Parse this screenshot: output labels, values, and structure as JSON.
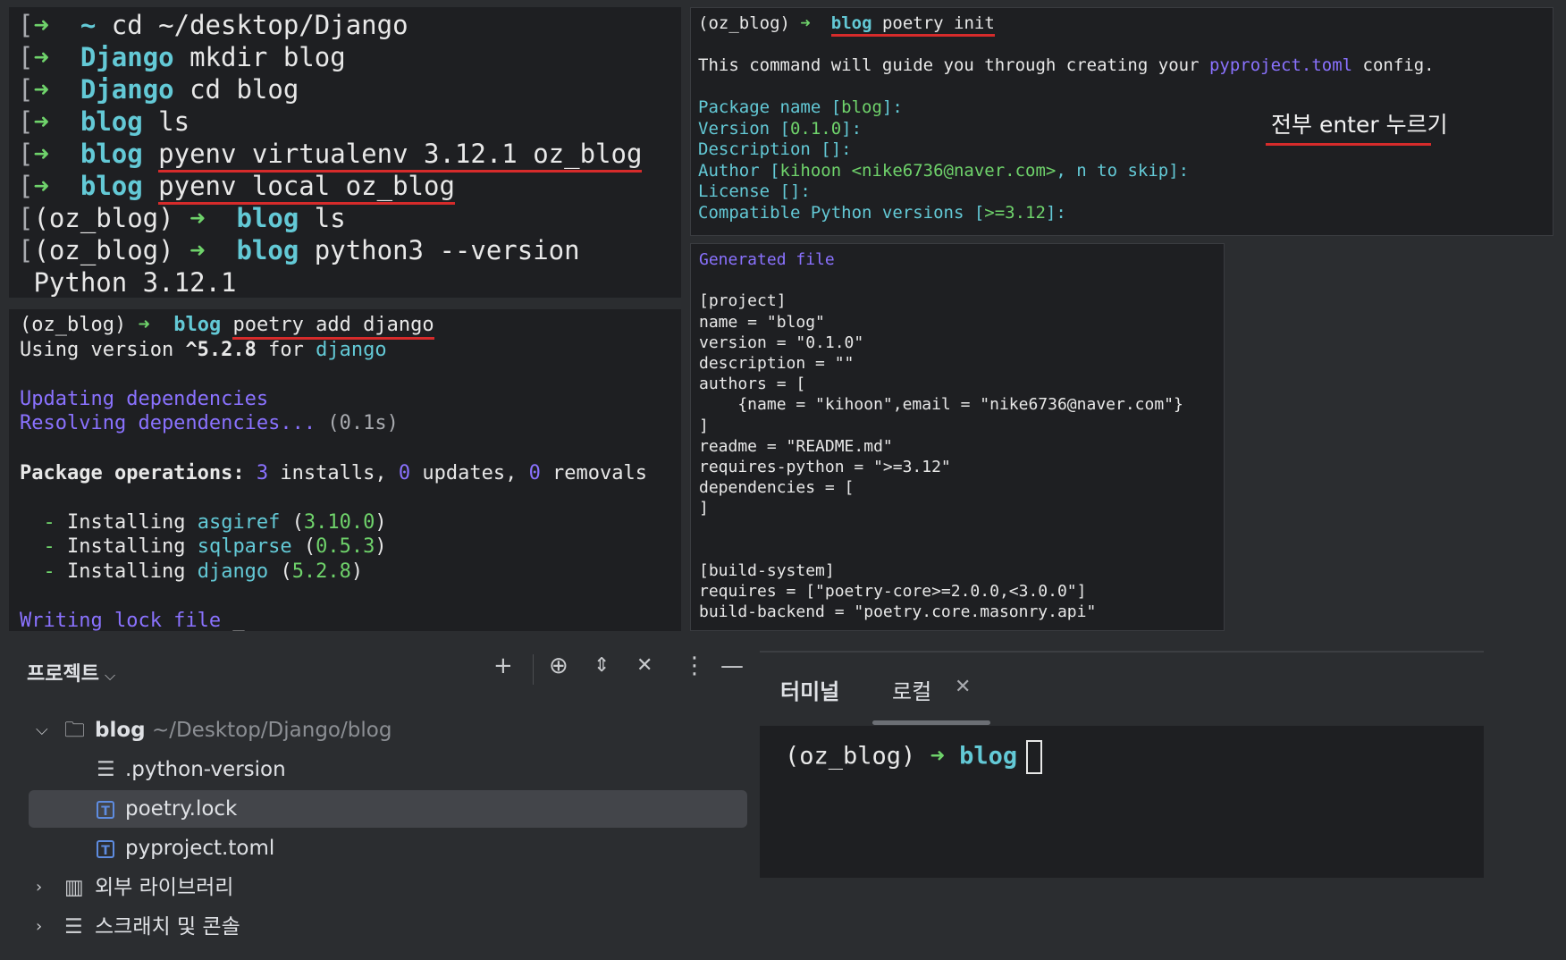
{
  "terminal_top_left": {
    "lines": [
      {
        "prompt": "➜",
        "dir": "~",
        "cmd": "cd ~/desktop/Django"
      },
      {
        "prompt": "➜",
        "dir": "Django",
        "cmd": "mkdir blog"
      },
      {
        "prompt": "➜",
        "dir": "Django",
        "cmd": "cd blog"
      },
      {
        "prompt": "➜",
        "dir": "blog",
        "cmd": "ls"
      },
      {
        "prompt": "➜",
        "dir": "blog",
        "cmd": "pyenv virtualenv 3.12.1 oz_blog"
      },
      {
        "prompt": "➜",
        "dir": "blog",
        "cmd": "pyenv local oz_blog"
      },
      {
        "env": "(oz_blog)",
        "prompt": "➜",
        "dir": "blog",
        "cmd": "ls"
      },
      {
        "env": "(oz_blog)",
        "prompt": "➜",
        "dir": "blog",
        "cmd": "python3 --version"
      }
    ],
    "output": "Python 3.12.1"
  },
  "terminal_init": {
    "env": "(oz_blog)",
    "prompt": "➜",
    "dir": "blog",
    "cmd": "poetry init",
    "guide_prefix": "This command will guide you through creating your ",
    "guide_file": "pyproject.toml",
    "guide_suffix": " config.",
    "q1_label": "Package name [",
    "q1_value": "blog",
    "q1_end": "]:",
    "q2_label": "Version [",
    "q2_value": "0.1.0",
    "q2_end": "]:",
    "q3": "Description []:",
    "q4_label": "Author [",
    "q4_value": "kihoon <nike6736@naver.com>",
    "q4_mid": ", n to skip]:",
    "q5": "License []:",
    "q6_label": "Compatible Python versions [",
    "q6_value": ">=3.12",
    "q6_end": "]:"
  },
  "annotation": "전부 enter 누르기",
  "terminal_add": {
    "env": "(oz_blog)",
    "prompt": "➜",
    "dir": "blog",
    "cmd": "poetry add django",
    "using_prefix": "Using version ",
    "using_version": "^5.2.8",
    "using_mid": " for ",
    "using_pkg": "django",
    "updating": "Updating dependencies",
    "resolving": "Resolving dependencies...",
    "resolving_time": " (0.1s)",
    "ops_label": "Package operations: ",
    "installs_n": "3",
    "installs_t": " installs, ",
    "updates_n": "0",
    "updates_t": " updates, ",
    "removals_n": "0",
    "removals_t": " removals",
    "installs": [
      {
        "pkg": "asgiref",
        "ver": "3.10.0"
      },
      {
        "pkg": "sqlparse",
        "ver": "0.5.3"
      },
      {
        "pkg": "django",
        "ver": "5.2.8"
      }
    ],
    "install_label": "Installing",
    "writing": "Writing lock file"
  },
  "generated_file": {
    "title": "Generated file",
    "lines": [
      "",
      "[project]",
      "name = \"blog\"",
      "version = \"0.1.0\"",
      "description = \"\"",
      "authors = [",
      "    {name = \"kihoon\",email = \"nike6736@naver.com\"}",
      "]",
      "readme = \"README.md\"",
      "requires-python = \">=3.12\"",
      "dependencies = [",
      "]",
      "",
      "",
      "[build-system]",
      "requires = [\"poetry-core>=2.0.0,<3.0.0\"]",
      "build-backend = \"poetry.core.masonry.api\""
    ]
  },
  "project_panel": {
    "title": "프로젝트",
    "root_name": "blog",
    "root_path": "~/Desktop/Django/blog",
    "files": [
      ".python-version",
      "poetry.lock",
      "pyproject.toml"
    ],
    "external": "외부 라이브러리",
    "scratches": "스크래치 및 콘솔"
  },
  "terminal_panel": {
    "tab_terminal": "터미널",
    "tab_local": "로컬",
    "env": "(oz_blog)",
    "prompt": "➜",
    "dir": "blog"
  },
  "icons": [
    "plus-icon",
    "crosshair-icon",
    "expand-icon",
    "collapse-icon",
    "more-icon",
    "minimize-icon",
    "folder-icon",
    "text-file-icon",
    "toml-file-icon",
    "library-icon",
    "scratch-icon",
    "close-icon",
    "chevron-down-icon",
    "chevron-right-icon"
  ]
}
